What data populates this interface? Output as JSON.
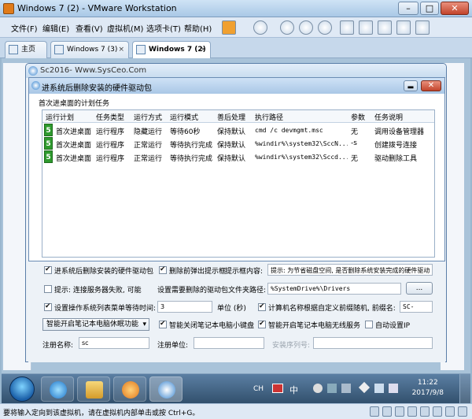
{
  "vmware": {
    "window_title": "Windows 7 (2) - VMware Workstation",
    "menu": [
      "文件(F)",
      "编辑(E)",
      "查看(V)",
      "虚拟机(M)",
      "选项卡(T)",
      "帮助(H)"
    ],
    "tabs": [
      {
        "label": "主页"
      },
      {
        "label": "Windows 7 (3)"
      },
      {
        "label": "Windows 7 (2)"
      }
    ],
    "status_text": "要将输入定向到该虚拟机，请在虚拟机内部单击或按 Ctrl+G。"
  },
  "outer_window": {
    "title": "Sc2016- Www.SysCeo.Com"
  },
  "dialog": {
    "title": "进系统后删除安装的硬件驱动包",
    "close_label": "✕",
    "grid_caption": "首次进桌面的计划任务",
    "columns": [
      "运行计划",
      "任务类型",
      "运行方式",
      "运行模式",
      "善后处理",
      "执行路径",
      "参数",
      "任务说明"
    ],
    "rows": [
      {
        "num": "5",
        "plan": "首次进桌面",
        "type": "运行程序",
        "mode": "隐藏运行",
        "run": "等待60秒",
        "after": "保持默认",
        "path": "cmd /c devmgmt.msc",
        "param": "无",
        "desc": "调用设备管理器"
      },
      {
        "num": "5",
        "plan": "首次进桌面",
        "type": "运行程序",
        "mode": "正常运行",
        "run": "等待执行完成",
        "after": "保持默认",
        "path": "%windir%\\system32\\SccN...",
        "param": "-s",
        "desc": "创建拨号连接"
      },
      {
        "num": "5",
        "plan": "首次进桌面",
        "type": "运行程序",
        "mode": "正常运行",
        "run": "等待执行完成",
        "after": "保持默认",
        "path": "%windir%\\system32\\Sccd...",
        "param": "无",
        "desc": "驱动删除工具"
      }
    ]
  },
  "options": {
    "del_driver_pkg": {
      "label": "进系统后删除安装的硬件驱动包",
      "checked": true
    },
    "del_prompt": {
      "label": "删除前弹出提示框",
      "checked": true
    },
    "prompt_content_label": "提示框内容:",
    "prompt_content_value": "提示: 为节省磁盘空间, 是否删除系统安装完成的硬件驱动",
    "conn_fail": {
      "label": "提示: 连接服务器失败, 可能",
      "checked": false
    },
    "driver_folder_label": "设置需要删除的驱动包文件夹路径:",
    "driver_folder_value": "%SystemDrive%\\Drivers",
    "browse_label": "...",
    "menu_wait": {
      "label": "设置操作系统列表菜单等待时间:",
      "checked": true
    },
    "menu_wait_value": "3",
    "menu_wait_unit": "单位 (秒)",
    "computer_name": {
      "label": "计算机名称根据自定义前缀随机, 前缀名:",
      "checked": true
    },
    "prefix_value": "SC-",
    "sleep_select_value": "智能开启笔记本电脑休眠功能",
    "kbd_off": {
      "label": "智能关闭笔记本电脑小键盘",
      "checked": true
    },
    "wireless_on": {
      "label": "智能开启笔记本电脑无线服务",
      "checked": true
    },
    "auto_ip": {
      "label": "自动设置IP",
      "checked": false
    },
    "reg_name_label": "注册名称:",
    "reg_name_value": "sc",
    "reg_unit_label": "注册单位:",
    "reg_unit_value": "",
    "serial_label": "安装序列号:",
    "serial_value": ""
  },
  "taskbar": {
    "ime": "CH",
    "ime_char": "中",
    "time": "11:22",
    "date": "2017/9/8"
  }
}
